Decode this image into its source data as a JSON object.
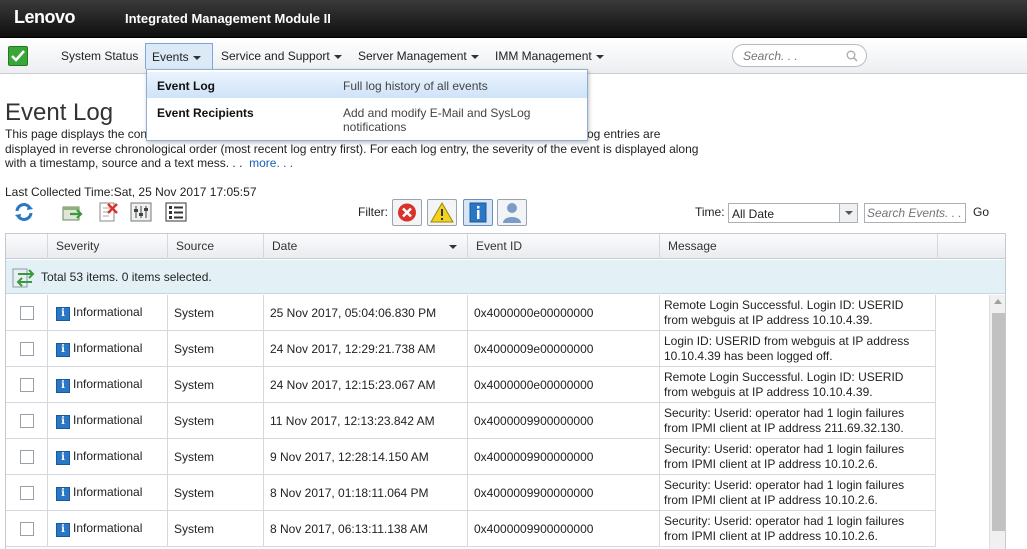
{
  "app": {
    "brand": "Lenovo",
    "product": "Integrated Management Module II"
  },
  "nav": {
    "items": [
      {
        "label": "System Status",
        "has_caret": false
      },
      {
        "label": "Events",
        "has_caret": true,
        "active": true
      },
      {
        "label": "Service and Support",
        "has_caret": true
      },
      {
        "label": "Server Management",
        "has_caret": true
      },
      {
        "label": "IMM Management",
        "has_caret": true
      }
    ],
    "search_placeholder": "Search. . ."
  },
  "events_menu": [
    {
      "label": "Event Log",
      "description": "Full log history of all events",
      "highlighted": true
    },
    {
      "label": "Event Recipients",
      "description": "Add and modify E-Mail and SysLog notifications"
    }
  ],
  "page": {
    "title": "Event Log",
    "description_line1_start": "This page displays the con",
    "description_line1_end": "og entries are",
    "description_line2": "displayed in reverse chronological order (most recent log entry first). For each log entry, the severity of the event is displayed along",
    "description_line3": "with a timestamp, source and a text mess. . .",
    "more_link": "more. . .",
    "last_collected": "Last Collected Time:Sat, 25 Nov 2017 17:05:57"
  },
  "toolbar": {
    "filter_label": "Filter:",
    "time_label": "Time:",
    "time_value": "All Date",
    "search_placeholder": "Search Events. . .",
    "go_label": "Go"
  },
  "table": {
    "columns": [
      "Severity",
      "Source",
      "Date",
      "Event ID",
      "Message"
    ],
    "summary": "Total 53 items. 0 items selected.",
    "rows": [
      {
        "severity": "Informational",
        "source": "System",
        "date": "25 Nov 2017, 05:04:06.830 PM",
        "event_id": "0x4000000e00000000",
        "message": "Remote Login Successful. Login ID: USERID from webguis at IP address 10.10.4.39."
      },
      {
        "severity": "Informational",
        "source": "System",
        "date": "24 Nov 2017, 12:29:21.738 AM",
        "event_id": "0x4000009e00000000",
        "message": "Login ID: USERID from webguis at IP address 10.10.4.39 has been logged off."
      },
      {
        "severity": "Informational",
        "source": "System",
        "date": "24 Nov 2017, 12:15:23.067 AM",
        "event_id": "0x4000000e00000000",
        "message": "Remote Login Successful. Login ID: USERID from webguis at IP address 10.10.4.39."
      },
      {
        "severity": "Informational",
        "source": "System",
        "date": "11 Nov 2017, 12:13:23.842 AM",
        "event_id": "0x4000009900000000",
        "message": "Security: Userid: operator had 1 login failures from IPMI client at IP address 211.69.32.130."
      },
      {
        "severity": "Informational",
        "source": "System",
        "date": "9 Nov 2017, 12:28:14.150 AM",
        "event_id": "0x4000009900000000",
        "message": "Security: Userid: operator had 1 login failures from IPMI client at IP address 10.10.2.6."
      },
      {
        "severity": "Informational",
        "source": "System",
        "date": "8 Nov 2017, 01:18:11.064 PM",
        "event_id": "0x4000009900000000",
        "message": "Security: Userid: operator had 1 login failures from IPMI client at IP address 10.10.2.6."
      },
      {
        "severity": "Informational",
        "source": "System",
        "date": "8 Nov 2017, 06:13:11.138 AM",
        "event_id": "0x4000009900000000",
        "message": "Security: Userid: operator had 1 login failures from IPMI client at IP address 10.10.2.6."
      }
    ]
  },
  "colors": {
    "accent": "#2a77c5",
    "header_bg": "#1c1c1c",
    "status_ok": "#3aa63a",
    "error": "#d9322b",
    "warning": "#f2d21c"
  }
}
